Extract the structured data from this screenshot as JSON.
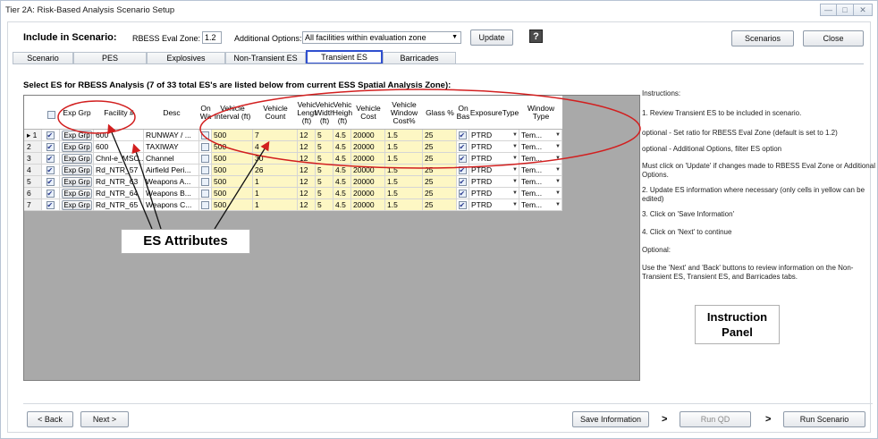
{
  "window": {
    "title": "Tier 2A: Risk-Based Analysis Scenario Setup",
    "min": "—",
    "max": "□",
    "close": "✕"
  },
  "header": {
    "include_label": "Include in Scenario:",
    "eval_zone_label": "RBESS Eval Zone:",
    "eval_zone_value": "1.2",
    "additional_label": "Additional Options:",
    "additional_value": "All facilities within evaluation zone",
    "update": "Update",
    "help": "?",
    "scenarios": "Scenarios",
    "close": "Close"
  },
  "tabs": [
    "Scenario",
    "PES",
    "Explosives",
    "Non-Transient ES",
    "Transient ES",
    "Barricades"
  ],
  "active_tab": "Transient ES",
  "select_caption": "Select ES for RBESS Analysis (7 of 33 total ES's are listed below from current ESS Spatial Analysis Zone):",
  "columns": [
    "",
    "",
    "Exp Grp",
    "Facility #",
    "Desc",
    "On Wa",
    "Vehicle Interval (ft)",
    "Vehicle Count",
    "Vehic Lengt (ft)",
    "Vehic Width (ft)",
    "Vehic Heigh (ft)",
    "Vehicle Cost",
    "Vehicle Window Cost%",
    "Glass %",
    "On Bas",
    "ExposureType",
    "Window Type"
  ],
  "rows": [
    {
      "rn": "▸ 1",
      "facility": "600",
      "desc": "RUNWAY / ...",
      "interval": "500",
      "count": "7",
      "len": "12",
      "wid": "5",
      "hgt": "4.5",
      "cost": "20000",
      "wcost": "1.5",
      "glass": "25",
      "exposure": "PTRD",
      "window": "Tem..."
    },
    {
      "rn": "2",
      "facility": "600",
      "desc": "TAXIWAY",
      "interval": "500",
      "count": "4",
      "len": "12",
      "wid": "5",
      "hgt": "4.5",
      "cost": "20000",
      "wcost": "1.5",
      "glass": "25",
      "exposure": "PTRD",
      "window": "Tem..."
    },
    {
      "rn": "3",
      "facility": "Chnl-e_MSC...",
      "desc": "Channel",
      "interval": "500",
      "count": "30",
      "len": "12",
      "wid": "5",
      "hgt": "4.5",
      "cost": "20000",
      "wcost": "1.5",
      "glass": "25",
      "exposure": "PTRD",
      "window": "Tem..."
    },
    {
      "rn": "4",
      "facility": "Rd_NTR_57",
      "desc": "Airfield Peri...",
      "interval": "500",
      "count": "26",
      "len": "12",
      "wid": "5",
      "hgt": "4.5",
      "cost": "20000",
      "wcost": "1.5",
      "glass": "25",
      "exposure": "PTRD",
      "window": "Tem..."
    },
    {
      "rn": "5",
      "facility": "Rd_NTR_63",
      "desc": "Weapons A...",
      "interval": "500",
      "count": "1",
      "len": "12",
      "wid": "5",
      "hgt": "4.5",
      "cost": "20000",
      "wcost": "1.5",
      "glass": "25",
      "exposure": "PTRD",
      "window": "Tem..."
    },
    {
      "rn": "6",
      "facility": "Rd_NTR_64",
      "desc": "Weapons B...",
      "interval": "500",
      "count": "1",
      "len": "12",
      "wid": "5",
      "hgt": "4.5",
      "cost": "20000",
      "wcost": "1.5",
      "glass": "25",
      "exposure": "PTRD",
      "window": "Tem..."
    },
    {
      "rn": "7",
      "facility": "Rd_NTR_65",
      "desc": "Weapons C...",
      "interval": "500",
      "count": "1",
      "len": "12",
      "wid": "5",
      "hgt": "4.5",
      "cost": "20000",
      "wcost": "1.5",
      "glass": "25",
      "exposure": "PTRD",
      "window": "Tem..."
    }
  ],
  "exp_grp_button": "Exp Grp",
  "instructions": [
    "Instructions:",
    "1. Review Transient ES to be included in scenario.",
    "optional - Set ratio for RBESS Eval Zone (default is set to 1.2)",
    "optional - Additional Options, filter ES option",
    "Must click on 'Update' if changes made to RBESS Eval Zone or Additional Options.",
    "2. Update ES information where necessary (only cells in yellow can be edited)",
    "3. Click on 'Save Information'",
    "4. Click on 'Next' to continue",
    "Optional:",
    "Use the 'Next' and 'Back' buttons to review information on the Non-Transient  ES, Transient ES, and Barricades tabs."
  ],
  "annotations": {
    "es_attributes": "ES Attributes",
    "instruction_panel_1": "Instruction",
    "instruction_panel_2": "Panel"
  },
  "footer": {
    "back": "<  Back",
    "next": "Next  >",
    "save": "Save Information",
    "run_qd": "Run QD",
    "run_scenario": "Run Scenario",
    "arrow": ">"
  },
  "colors": {
    "annotation": "#d21f1f",
    "editable": "#fdf7c4",
    "active_tab_border": "#2f4fcf",
    "grid_bg": "#a9a9a9"
  }
}
